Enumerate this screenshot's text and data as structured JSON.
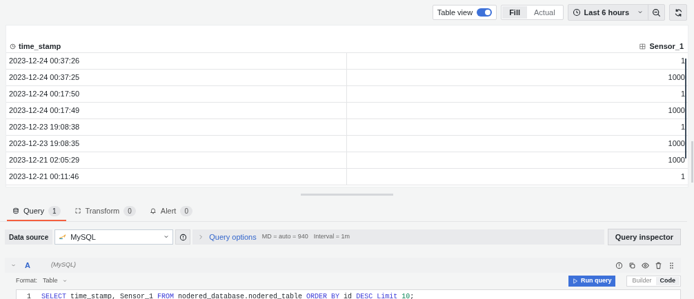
{
  "toolbar": {
    "table_view": {
      "label": "Table view",
      "on": true
    },
    "display_modes": [
      {
        "label": "Fill",
        "selected": true
      },
      {
        "label": "Actual",
        "selected": false
      }
    ],
    "time_range": "Last 6 hours"
  },
  "table": {
    "columns": [
      "time_stamp",
      "Sensor_1"
    ],
    "rows": [
      [
        "2023-12-24 00:37:26",
        "1"
      ],
      [
        "2023-12-24 00:37:25",
        "1000"
      ],
      [
        "2023-12-24 00:17:50",
        "1"
      ],
      [
        "2023-12-24 00:17:49",
        "1000"
      ],
      [
        "2023-12-23 19:08:38",
        "1"
      ],
      [
        "2023-12-23 19:08:35",
        "1000"
      ],
      [
        "2023-12-21 02:05:29",
        "1000"
      ],
      [
        "2023-12-21 00:11:46",
        "1"
      ]
    ]
  },
  "editor_tabs": [
    {
      "label": "Query",
      "count": "1",
      "selected": true,
      "kind": "query"
    },
    {
      "label": "Transform",
      "count": "0",
      "selected": false,
      "kind": "transform"
    },
    {
      "label": "Alert",
      "count": "0",
      "selected": false,
      "kind": "alert"
    }
  ],
  "data_source": {
    "label": "Data source",
    "value": "MySQL",
    "query_options": "Query options",
    "md": "MD = auto = 940",
    "interval": "Interval = 1m",
    "inspector": "Query inspector"
  },
  "query": {
    "ref": "A",
    "source": "(MySQL)",
    "format_label": "Format:",
    "format": "Table",
    "run": "Run query",
    "modes": [
      {
        "label": "Builder",
        "selected": false
      },
      {
        "label": "Code",
        "selected": true
      }
    ],
    "line_number": "1",
    "code": [
      {
        "text": "SELECT",
        "kind": "keyword"
      },
      {
        "text": " time_stamp, Sensor_1 ",
        "kind": "ident"
      },
      {
        "text": "FROM",
        "kind": "keyword"
      },
      {
        "text": " nodered_database.nodered_table ",
        "kind": "ident"
      },
      {
        "text": "ORDER BY",
        "kind": "keyword"
      },
      {
        "text": " id ",
        "kind": "ident"
      },
      {
        "text": "DESC",
        "kind": "keyword"
      },
      {
        "text": " Limit",
        "kind": "keyword"
      },
      {
        "text": " 10",
        "kind": "number"
      },
      {
        "text": ";",
        "kind": "ident"
      }
    ]
  }
}
